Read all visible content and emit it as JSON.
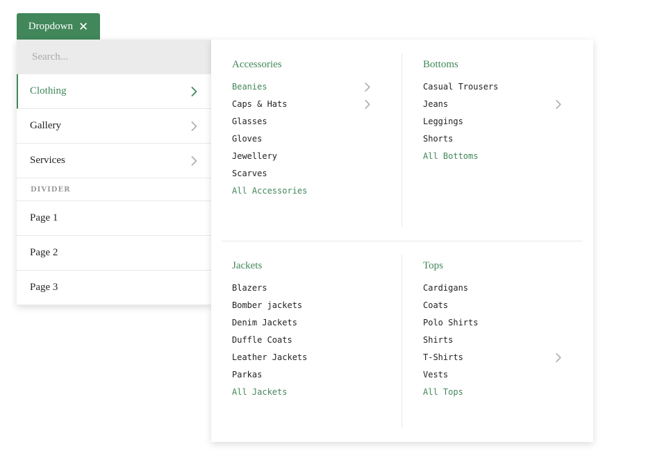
{
  "trigger": {
    "label": "Dropdown",
    "close_icon": "close-icon"
  },
  "search": {
    "placeholder": "Search..."
  },
  "menu": {
    "items": [
      {
        "label": "Clothing",
        "active": true,
        "has_submenu": true
      },
      {
        "label": "Gallery",
        "active": false,
        "has_submenu": true
      },
      {
        "label": "Services",
        "active": false,
        "has_submenu": true
      }
    ],
    "divider_label": "DIVIDER",
    "pages": [
      {
        "label": "Page 1"
      },
      {
        "label": "Page 2"
      },
      {
        "label": "Page 3"
      }
    ]
  },
  "panel": {
    "sections": [
      {
        "title": "Accessories",
        "links": [
          {
            "label": "Beanies",
            "green": true,
            "has_submenu": true
          },
          {
            "label": "Caps & Hats",
            "green": false,
            "has_submenu": true
          },
          {
            "label": "Glasses",
            "green": false,
            "has_submenu": false
          },
          {
            "label": "Gloves",
            "green": false,
            "has_submenu": false
          },
          {
            "label": "Jewellery",
            "green": false,
            "has_submenu": false
          },
          {
            "label": "Scarves",
            "green": false,
            "has_submenu": false
          },
          {
            "label": "All Accessories",
            "green": true,
            "has_submenu": false
          }
        ]
      },
      {
        "title": "Bottoms",
        "links": [
          {
            "label": "Casual Trousers",
            "green": false,
            "has_submenu": false
          },
          {
            "label": "Jeans",
            "green": false,
            "has_submenu": true
          },
          {
            "label": "Leggings",
            "green": false,
            "has_submenu": false
          },
          {
            "label": "Shorts",
            "green": false,
            "has_submenu": false
          },
          {
            "label": "All Bottoms",
            "green": true,
            "has_submenu": false
          }
        ]
      },
      {
        "title": "Jackets",
        "links": [
          {
            "label": "Blazers",
            "green": false,
            "has_submenu": false
          },
          {
            "label": "Bomber jackets",
            "green": false,
            "has_submenu": false
          },
          {
            "label": "Denim Jackets",
            "green": false,
            "has_submenu": false
          },
          {
            "label": "Duffle Coats",
            "green": false,
            "has_submenu": false
          },
          {
            "label": "Leather Jackets",
            "green": false,
            "has_submenu": false
          },
          {
            "label": "Parkas",
            "green": false,
            "has_submenu": false
          },
          {
            "label": "All Jackets",
            "green": true,
            "has_submenu": false
          }
        ]
      },
      {
        "title": "Tops",
        "links": [
          {
            "label": "Cardigans",
            "green": false,
            "has_submenu": false
          },
          {
            "label": "Coats",
            "green": false,
            "has_submenu": false
          },
          {
            "label": "Polo Shirts",
            "green": false,
            "has_submenu": false
          },
          {
            "label": "Shirts",
            "green": false,
            "has_submenu": false
          },
          {
            "label": "T-Shirts",
            "green": false,
            "has_submenu": true
          },
          {
            "label": "Vests",
            "green": false,
            "has_submenu": false
          },
          {
            "label": "All Tops",
            "green": true,
            "has_submenu": false
          }
        ]
      }
    ]
  },
  "colors": {
    "accent": "#41875a",
    "chevron": "#b0b0b0",
    "search_bg": "#ebebeb"
  }
}
